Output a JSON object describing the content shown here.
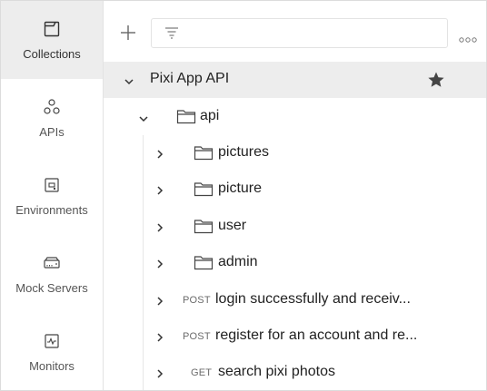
{
  "sidebar": {
    "items": [
      {
        "label": "Collections",
        "icon": "collections-icon",
        "active": true
      },
      {
        "label": "APIs",
        "icon": "apis-icon",
        "active": false
      },
      {
        "label": "Environments",
        "icon": "environments-icon",
        "active": false
      },
      {
        "label": "Mock Servers",
        "icon": "mock-servers-icon",
        "active": false
      },
      {
        "label": "Monitors",
        "icon": "monitors-icon",
        "active": false
      }
    ]
  },
  "toolbar": {
    "add_icon": "plus-icon",
    "filter_icon": "filter-icon",
    "filter_value": "",
    "more_icon": "more-options-icon"
  },
  "tree": {
    "collection": {
      "name": "Pixi App API",
      "starred": true
    },
    "folder_root": {
      "name": "api"
    },
    "folders": [
      {
        "name": "pictures"
      },
      {
        "name": "picture"
      },
      {
        "name": "user"
      },
      {
        "name": "admin"
      }
    ],
    "requests": [
      {
        "method": "POST",
        "name": "login successfully and receiv..."
      },
      {
        "method": "POST",
        "name": "register for an account and re..."
      },
      {
        "method": "GET",
        "name": "search pixi photos"
      }
    ]
  },
  "colors": {
    "active_bg": "#ededed",
    "text": "#212121",
    "muted": "#6b6b6b",
    "border": "#e3e3e3"
  }
}
